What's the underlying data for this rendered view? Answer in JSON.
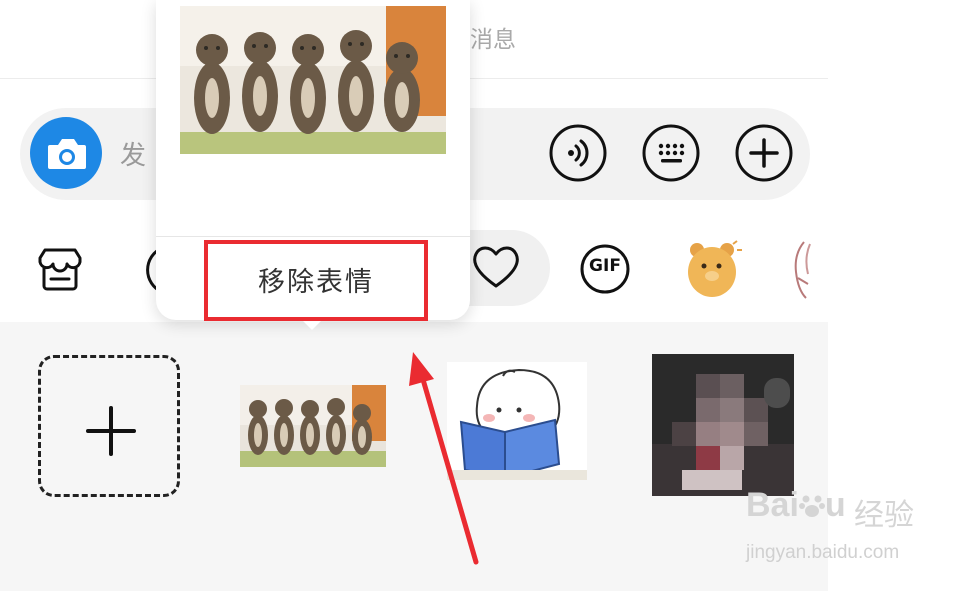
{
  "header": {
    "title_partial": "消息"
  },
  "composer": {
    "placeholder_partial": "发"
  },
  "popup": {
    "remove_label": "移除表情"
  },
  "tray": {
    "gif_label": "GIF"
  },
  "watermark": {
    "logo": "Bai",
    "logo_end": "u",
    "cn": "经验",
    "url": "jingyan.baidu.com"
  },
  "colors": {
    "accent": "#1e88e5",
    "highlight": "#ea2b31"
  }
}
